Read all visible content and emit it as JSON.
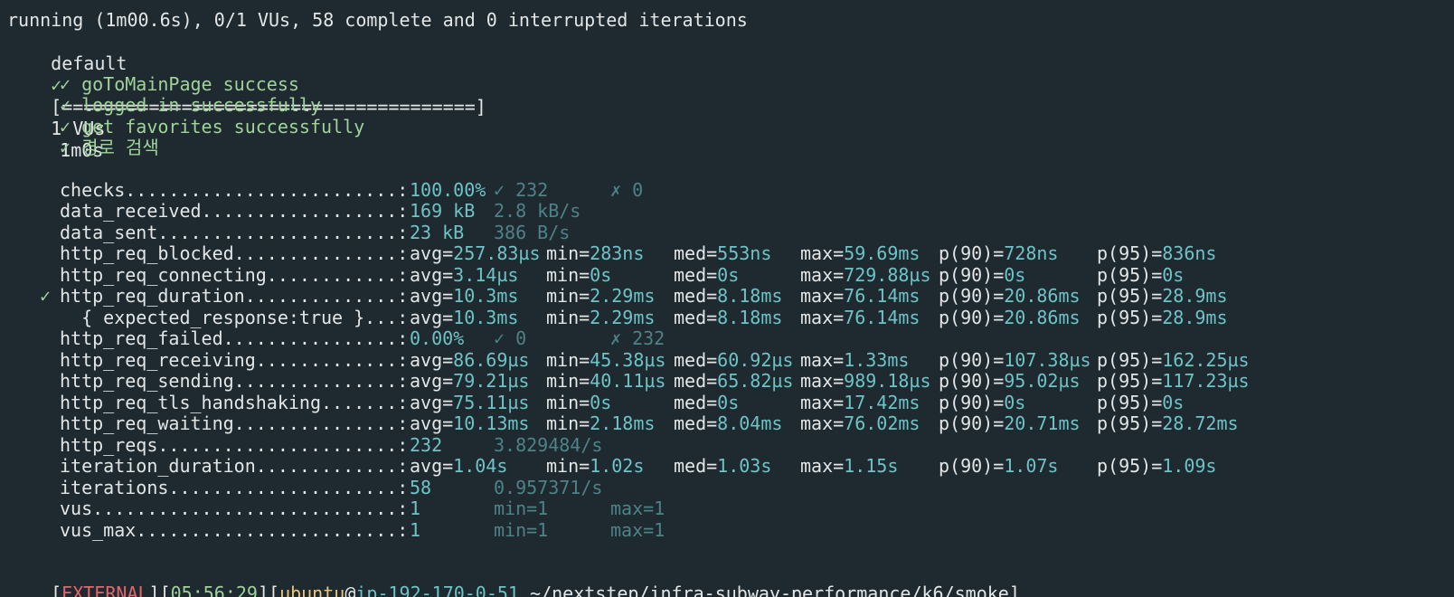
{
  "header": {
    "running": "running (1m00.6s), 0/1 VUs, 58 complete and 0 interrupted iterations",
    "default_label": "default",
    "default_check": "✓",
    "progress_bar": "[======================================]",
    "vus": "1 VUs",
    "duration": "1m0s"
  },
  "checks": [
    "✓ goToMainPage success",
    "✓ logged in successfully",
    "✓ get favorites successfully",
    "✓ 경로 검색"
  ],
  "metrics": [
    {
      "name": "checks",
      "dots": ".........................:",
      "v1": "100.00%",
      "v2": "✓ 232",
      "v3": "✗ 0"
    },
    {
      "name": "data_received",
      "dots": "..................:",
      "v1": "169 kB",
      "v2": "2.8 kB/s"
    },
    {
      "name": "data_sent",
      "dots": "......................:",
      "v1": "23 kB",
      "v2": "386 B/s"
    },
    {
      "name": "http_req_blocked",
      "dots": "...............:",
      "avg": "avg=257.83µs",
      "min": "min=283ns",
      "med": "med=553ns",
      "max": "max=59.69ms",
      "p90": "p(90)=728ns",
      "p95": "p(95)=836ns"
    },
    {
      "name": "http_req_connecting",
      "dots": "............:",
      "avg": "avg=3.14µs",
      "min": "min=0s",
      "med": "med=0s",
      "max": "max=729.88µs",
      "p90": "p(90)=0s",
      "p95": "p(95)=0s"
    },
    {
      "prefix": "✓ ",
      "name": "http_req_duration",
      "dots": "..............:",
      "avg": "avg=10.3ms",
      "min": "min=2.29ms",
      "med": "med=8.18ms",
      "max": "max=76.14ms",
      "p90": "p(90)=20.86ms",
      "p95": "p(95)=28.9ms"
    },
    {
      "name": "  { expected_response:true }",
      "dots": "...:",
      "avg": "avg=10.3ms",
      "min": "min=2.29ms",
      "med": "med=8.18ms",
      "max": "max=76.14ms",
      "p90": "p(90)=20.86ms",
      "p95": "p(95)=28.9ms"
    },
    {
      "name": "http_req_failed",
      "dots": "................:",
      "v1": "0.00%",
      "v2": "✓ 0",
      "v3": "✗ 232"
    },
    {
      "name": "http_req_receiving",
      "dots": ".............:",
      "avg": "avg=86.69µs",
      "min": "min=45.38µs",
      "med": "med=60.92µs",
      "max": "max=1.33ms",
      "p90": "p(90)=107.38µs",
      "p95": "p(95)=162.25µs"
    },
    {
      "name": "http_req_sending",
      "dots": "...............:",
      "avg": "avg=79.21µs",
      "min": "min=40.11µs",
      "med": "med=65.82µs",
      "max": "max=989.18µs",
      "p90": "p(90)=95.02µs",
      "p95": "p(95)=117.23µs"
    },
    {
      "name": "http_req_tls_handshaking",
      "dots": ".......:",
      "avg": "avg=75.11µs",
      "min": "min=0s",
      "med": "med=0s",
      "max": "max=17.42ms",
      "p90": "p(90)=0s",
      "p95": "p(95)=0s"
    },
    {
      "name": "http_req_waiting",
      "dots": "...............:",
      "avg": "avg=10.13ms",
      "min": "min=2.18ms",
      "med": "med=8.04ms",
      "max": "max=76.02ms",
      "p90": "p(90)=20.71ms",
      "p95": "p(95)=28.72ms"
    },
    {
      "name": "http_reqs",
      "dots": "......................:",
      "v1": "232",
      "v2": "3.829484/s"
    },
    {
      "name": "iteration_duration",
      "dots": ".............:",
      "avg": "avg=1.04s",
      "min": "min=1.02s",
      "med": "med=1.03s",
      "max": "max=1.15s",
      "p90": "p(90)=1.07s",
      "p95": "p(95)=1.09s"
    },
    {
      "name": "iterations",
      "dots": ".....................:",
      "v1": "58",
      "v2": "0.957371/s"
    },
    {
      "name": "vus",
      "dots": "............................:",
      "v1": "1",
      "v2": "min=1",
      "v3": "max=1"
    },
    {
      "name": "vus_max",
      "dots": "........................:",
      "v1": "1",
      "v2": "min=1",
      "v3": "max=1"
    }
  ],
  "prompt": {
    "lb1": "[",
    "tag": "EXTERNAL",
    "mid1": "][",
    "time": "05:56:29",
    "mid2": "][",
    "user": "ubuntu",
    "at": "@",
    "host": "ip-192-170-0-51",
    "path": " ~/nextstep/infra-subway-performance/k6/smoke]"
  },
  "colors": {
    "background": "#1e2a30",
    "text": "#e4e6e6",
    "green": "#9fd39a",
    "cyan": "#6ec3c7",
    "dim": "#4d8288",
    "red": "#e0666c",
    "yellow": "#f0c67a"
  }
}
